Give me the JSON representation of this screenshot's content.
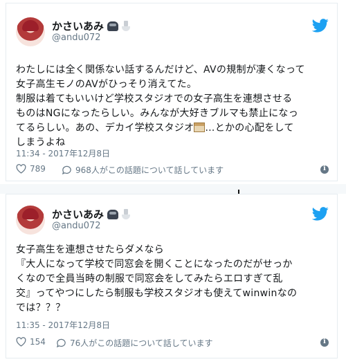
{
  "tweets": [
    {
      "name": "かさいあみ",
      "handle": "@andu072",
      "text": "わたしには全く関係ない話するんだけど、AVの規制が凄くなって\n女子高生モノのAVがひっそり消えてた。\n制服は着てもいいけど学校スタジオでの女子高生を連想させる\nものはNGになったらしい。みんなが大好きブルマも禁止になっ\nてるらしい。あの、デカイ学校スタジオ",
      "text_after_icon": "…とかの心配をして\nしまうよね",
      "timestamp": "11:34 - 2017年12月8日",
      "likes": "789",
      "replies_text": "968人がこの話題について話しています"
    },
    {
      "name": "かさいあみ",
      "handle": "@andu072",
      "text": "女子高生を連想させたらダメなら\n『大人になって学校で同窓会を開くことになったのだがせっか\nくなので全員当時の制服で同窓会をしてみたらエロすぎて乱\n交』ってやつにしたら制服も学校スタジオも使えてwinwinなの\nでは？？？",
      "timestamp": "11:35 - 2017年12月8日",
      "likes": "154",
      "replies_text": "76人がこの話題について話しています"
    }
  ],
  "icons": {
    "status_emoji_1": "car-icon",
    "status_emoji_2": "toilet-icon",
    "brand": "twitter-bird-icon",
    "like": "heart-icon",
    "reply": "reply-bubble-icon",
    "info": "info-icon",
    "inline_emoji": "school-building-icon"
  },
  "colors": {
    "brand": "#1da1f2",
    "muted": "#657786",
    "text": "#14171a"
  }
}
